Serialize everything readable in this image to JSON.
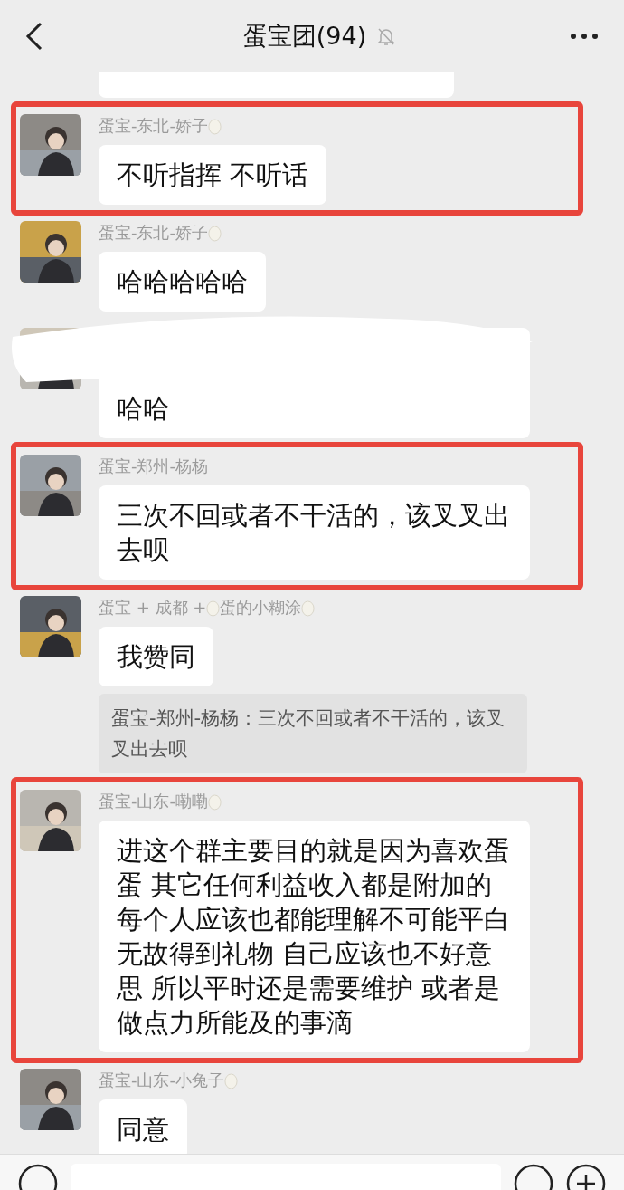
{
  "header": {
    "title": "蛋宝团(94)",
    "muted": true
  },
  "messages": [
    {
      "kind": "stub",
      "highlighted": false,
      "avatar": {
        "kind": "none"
      }
    },
    {
      "kind": "text",
      "name_parts": [
        {
          "kind": "text",
          "text": "蛋宝-东北-娇子"
        },
        {
          "kind": "egg"
        }
      ],
      "text": "不听指挥 不听话",
      "highlighted": true,
      "avatar": {
        "kind": "picture"
      }
    },
    {
      "kind": "text",
      "name_parts": [
        {
          "kind": "text",
          "text": "蛋宝-东北-娇子"
        },
        {
          "kind": "egg"
        }
      ],
      "text": "哈哈哈哈哈",
      "highlighted": false,
      "avatar": {
        "kind": "picture"
      }
    },
    {
      "kind": "redacted",
      "text": "哈哈",
      "highlighted": false,
      "avatar": {
        "kind": "picture"
      }
    },
    {
      "kind": "text",
      "name_parts": [
        {
          "kind": "text",
          "text": "蛋宝-郑州-杨杨"
        }
      ],
      "text": "三次不回或者不干活的，该叉叉出去呗",
      "highlighted": true,
      "avatar": {
        "kind": "picture"
      }
    },
    {
      "kind": "text",
      "name_parts": [
        {
          "kind": "text",
          "text": "蛋宝 + 成都 + "
        },
        {
          "kind": "egg"
        },
        {
          "kind": "text",
          "text": "蛋的小糊涂"
        },
        {
          "kind": "egg"
        }
      ],
      "text": "我赞同",
      "quote": "蛋宝-郑州-杨杨：三次不回或者不干活的，该叉叉出去呗",
      "highlighted": false,
      "avatar": {
        "kind": "picture"
      }
    },
    {
      "kind": "text",
      "name_parts": [
        {
          "kind": "text",
          "text": "蛋宝-山东-嘞嘞"
        },
        {
          "kind": "egg"
        }
      ],
      "text": "进这个群主要目的就是因为喜欢蛋蛋 其它任何利益收入都是附加的每个人应该也都能理解不可能平白无故得到礼物 自己应该也不好意思 所以平时还是需要维护 或者是做点力所能及的事滴",
      "highlighted": true,
      "avatar": {
        "kind": "picture"
      }
    },
    {
      "kind": "text",
      "name_parts": [
        {
          "kind": "text",
          "text": "蛋宝-山东-小兔子"
        },
        {
          "kind": "egg"
        }
      ],
      "text": "同意",
      "highlighted": false,
      "avatar": {
        "kind": "picture"
      }
    }
  ]
}
